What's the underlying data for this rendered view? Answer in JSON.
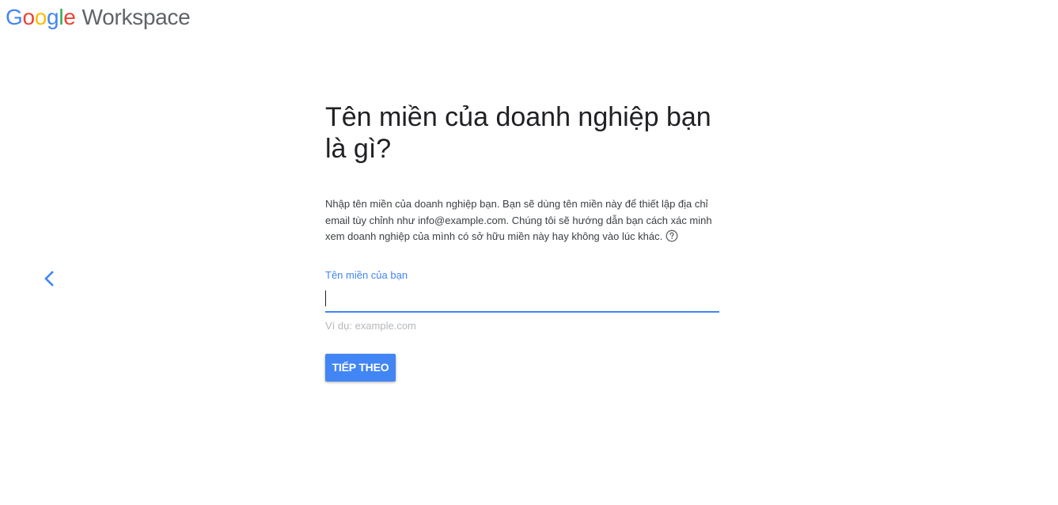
{
  "brand": {
    "letters": [
      {
        "char": "G",
        "color": "#4285F4"
      },
      {
        "char": "o",
        "color": "#EA4335"
      },
      {
        "char": "o",
        "color": "#FBBC05"
      },
      {
        "char": "g",
        "color": "#4285F4"
      },
      {
        "char": "l",
        "color": "#34A853"
      },
      {
        "char": "e",
        "color": "#EA4335"
      }
    ],
    "product": "Workspace"
  },
  "nav": {
    "back_icon": "chevron-left-icon"
  },
  "form": {
    "heading": "Tên miền của doanh nghiệp bạn là gì?",
    "description": "Nhập tên miền của doanh nghiệp bạn. Bạn sẽ dùng tên miền này để thiết lập địa chỉ email tùy chỉnh như info@example.com. Chúng tôi sẽ hướng dẫn bạn cách xác minh xem doanh nghiệp của mình có sở hữu miền này hay không vào lúc khác.",
    "help_icon": "help-circle-icon",
    "field_label": "Tên miền của bạn",
    "field_value": "",
    "hint": "Ví dụ: example.com",
    "next_label": "TIẾP THEO"
  },
  "colors": {
    "accent": "#4285f4",
    "heading": "#202124",
    "hint": "#b5b8bc"
  }
}
